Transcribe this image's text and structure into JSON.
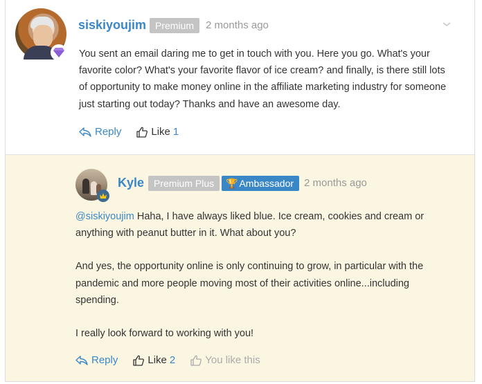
{
  "comment": {
    "username": "siskiyoujim",
    "badge": "Premium",
    "time": "2 months ago",
    "text": "You sent an email daring me to get in touch with you. Here you go. What's your favorite color? What's your favorite flavor of ice cream? and finally, is there still lots of opportunity to make money online in the affiliate marketing industry for someone just starting out today? Thanks and have an awesome day.",
    "reply_label": "Reply",
    "like_label": "Like",
    "like_count": "1"
  },
  "reply": {
    "username": "Kyle",
    "badge_plan": "Premium Plus",
    "badge_role": "Ambassador",
    "time": "2 months ago",
    "mention": "@siskiyoujim",
    "paragraph1_rest": " Haha, I have always liked blue. Ice cream, cookies and cream or anything with peanut butter in it. What about you?",
    "paragraph2": "And yes, the opportunity online is only continuing to grow, in particular with the pandemic and more people moving most of their activities online...including spending.",
    "paragraph3": "I really look forward to working with you!",
    "reply_label": "Reply",
    "like_label": "Like",
    "like_count": "2",
    "you_like": "You like this"
  },
  "colors": {
    "link": "#3a87c8",
    "badge_grey": "#c4c4c4",
    "reply_background": "#fbf6e2",
    "diamond": "#8a5cd6"
  },
  "icons": [
    "diamond-icon",
    "chevron-down-icon",
    "reply-arrow-icon",
    "thumbs-up-icon",
    "crown-icon",
    "trophy-icon"
  ]
}
